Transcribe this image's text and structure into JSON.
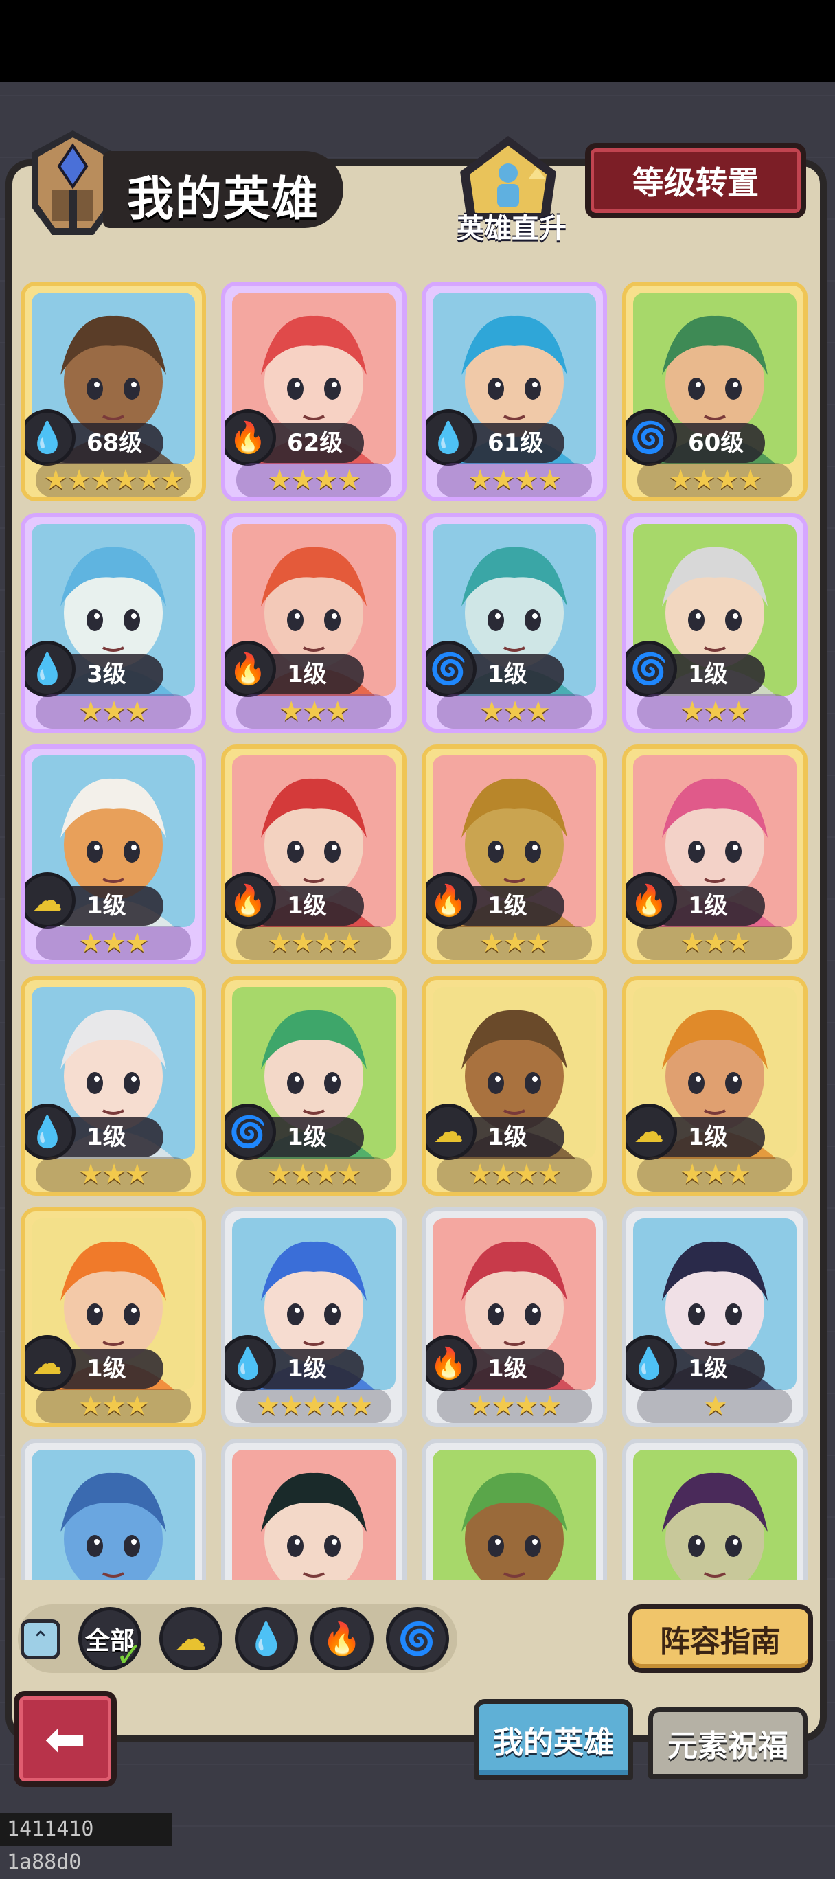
{
  "header": {
    "title": "我的英雄",
    "promote_label": "英雄直升",
    "level_transfer_label": "等级转置"
  },
  "colors": {
    "water": "#2f8fd8",
    "fire": "#e0504a",
    "wind": "#57b83a",
    "earth": "#e8c230",
    "gold_frame": "#efc555",
    "purple_frame": "#d6a6ff",
    "silver_frame": "#cfd4dc"
  },
  "heroes": [
    {
      "level": "68级",
      "stars": "★★★★★★",
      "element": "water",
      "frame": "gold",
      "skin": "#9a6b45",
      "hair": "#5a3d28",
      "bg": "#8ecbe6"
    },
    {
      "level": "62级",
      "stars": "★★★★",
      "element": "fire",
      "frame": "purple",
      "skin": "#f7d2c4",
      "hair": "#e04a4a",
      "bg": "#f4a7a0"
    },
    {
      "level": "61级",
      "stars": "★★★★",
      "element": "water",
      "frame": "purple",
      "skin": "#f0c9a8",
      "hair": "#2fa6d8",
      "bg": "#8ecbe6"
    },
    {
      "level": "60级",
      "stars": "★★★★",
      "element": "wind",
      "frame": "gold",
      "skin": "#e9b98d",
      "hair": "#3e8a55",
      "bg": "#a7d86a"
    },
    {
      "level": "3级",
      "stars": "★★★",
      "element": "water",
      "frame": "purple",
      "skin": "#e8f1ee",
      "hair": "#5fb4e0",
      "bg": "#8ecbe6"
    },
    {
      "level": "1级",
      "stars": "★★★",
      "element": "fire",
      "frame": "purple",
      "skin": "#f3c9b8",
      "hair": "#e45a3a",
      "bg": "#f4a7a0"
    },
    {
      "level": "1级",
      "stars": "★★★",
      "element": "wind",
      "frame": "purple",
      "skin": "#cfe6e6",
      "hair": "#3aa6a6",
      "bg": "#8ecbe6"
    },
    {
      "level": "1级",
      "stars": "★★★",
      "element": "wind",
      "frame": "purple",
      "skin": "#f2d7c0",
      "hair": "#d8d8d8",
      "bg": "#a7d86a"
    },
    {
      "level": "1级",
      "stars": "★★★",
      "element": "earth",
      "frame": "purple",
      "skin": "#e8a05a",
      "hair": "#f3f0ea",
      "bg": "#8ecbe6"
    },
    {
      "level": "1级",
      "stars": "★★★★",
      "element": "fire",
      "frame": "gold",
      "skin": "#f3d2c0",
      "hair": "#d43a3a",
      "bg": "#f4a7a0"
    },
    {
      "level": "1级",
      "stars": "★★★",
      "element": "fire",
      "frame": "gold",
      "skin": "#caa450",
      "hair": "#b8862a",
      "bg": "#f4a7a0"
    },
    {
      "level": "1级",
      "stars": "★★★",
      "element": "fire",
      "frame": "gold",
      "skin": "#f3d2c8",
      "hair": "#e05a8a",
      "bg": "#f4a7a0"
    },
    {
      "level": "1级",
      "stars": "★★★",
      "element": "water",
      "frame": "gold",
      "skin": "#f6ddd0",
      "hair": "#e8e8ea",
      "bg": "#8ecbe6"
    },
    {
      "level": "1级",
      "stars": "★★★★",
      "element": "wind",
      "frame": "gold",
      "skin": "#f3d8c8",
      "hair": "#3ea66a",
      "bg": "#a7d86a"
    },
    {
      "level": "1级",
      "stars": "★★★★",
      "element": "earth",
      "frame": "gold",
      "skin": "#a9723f",
      "hair": "#6a4a2a",
      "bg": "#f3e08a"
    },
    {
      "level": "1级",
      "stars": "★★★",
      "element": "earth",
      "frame": "gold",
      "skin": "#e0a070",
      "hair": "#e08a2a",
      "bg": "#f3e08a"
    },
    {
      "level": "1级",
      "stars": "★★★",
      "element": "earth",
      "frame": "gold",
      "skin": "#f3c9a8",
      "hair": "#f07a2a",
      "bg": "#f3e08a"
    },
    {
      "level": "1级",
      "stars": "★★★★★",
      "element": "water",
      "frame": "silver",
      "skin": "#f6dcd0",
      "hair": "#3a6ed8",
      "bg": "#8ecbe6"
    },
    {
      "level": "1级",
      "stars": "★★★★",
      "element": "fire",
      "frame": "silver",
      "skin": "#f3d2c4",
      "hair": "#c83a4a",
      "bg": "#f4a7a0"
    },
    {
      "level": "1级",
      "stars": "★",
      "element": "water",
      "frame": "silver",
      "skin": "#f0e0e6",
      "hair": "#2a2a4a",
      "bg": "#8ecbe6"
    },
    {
      "level": "",
      "stars": "",
      "element": "",
      "frame": "silver",
      "skin": "#6aa6e0",
      "hair": "#3a6ab0",
      "bg": "#8ecbe6"
    },
    {
      "level": "",
      "stars": "",
      "element": "",
      "frame": "silver",
      "skin": "#f3d8c8",
      "hair": "#1a2a2a",
      "bg": "#f4a7a0"
    },
    {
      "level": "",
      "stars": "",
      "element": "",
      "frame": "silver",
      "skin": "#9a6a3a",
      "hair": "#5aa64a",
      "bg": "#a7d86a"
    },
    {
      "level": "",
      "stars": "",
      "element": "",
      "frame": "silver",
      "skin": "#c8c89a",
      "hair": "#4a2a5a",
      "bg": "#a7d86a"
    }
  ],
  "filter": {
    "all_label": "全部",
    "elements": [
      "earth",
      "water",
      "fire",
      "wind"
    ]
  },
  "guide_label": "阵容指南",
  "tabs": {
    "my_heroes": "我的英雄",
    "element_blessing": "元素祝福"
  },
  "footer_id": "1411410 1a88d0"
}
